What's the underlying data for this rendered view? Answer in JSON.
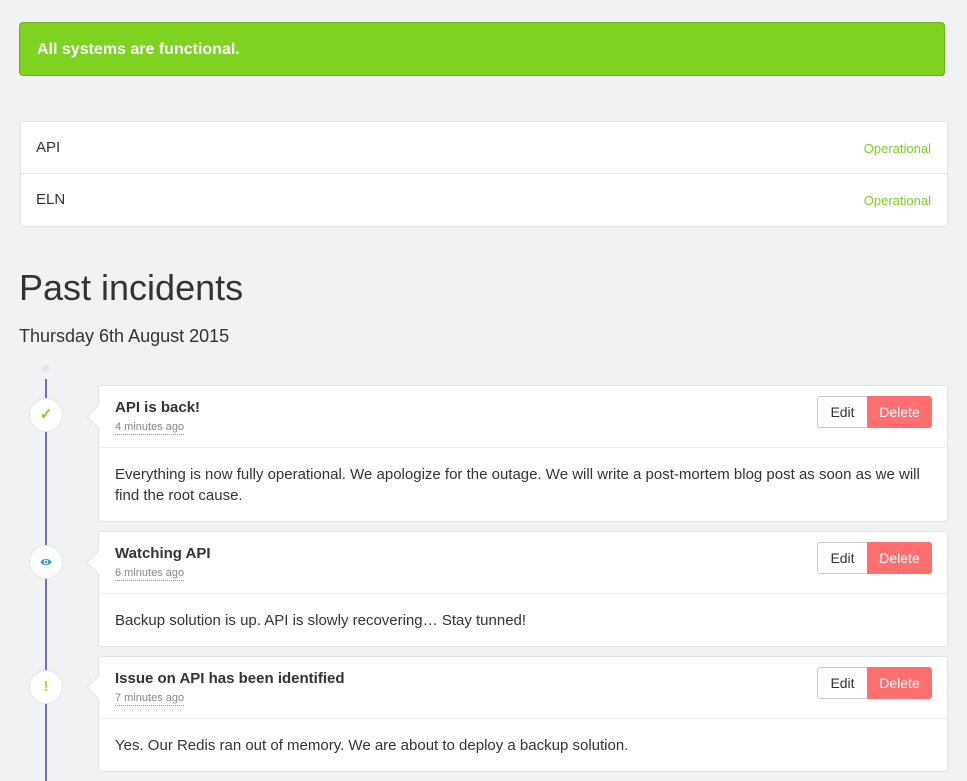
{
  "status_banner": {
    "text": "All systems are functional.",
    "color": "#7ed321"
  },
  "components": [
    {
      "name": "API",
      "status": "Operational"
    },
    {
      "name": "ELN",
      "status": "Operational"
    }
  ],
  "past_incidents": {
    "title": "Past incidents",
    "date": "Thursday 6th August 2015"
  },
  "actions": {
    "edit_label": "Edit",
    "delete_label": "Delete"
  },
  "incidents": [
    {
      "title": "API is back!",
      "time": "4 minutes ago",
      "message": "Everything is now fully operational. We apologize for the outage. We will write a post-mortem blog post as soon as we will find the root cause.",
      "icon": "check-icon",
      "icon_glyph": "✓",
      "icon_color": "#7ed321"
    },
    {
      "title": "Watching API",
      "time": "6 minutes ago",
      "message": "Backup solution is up. API is slowly recovering… Stay tunned!",
      "icon": "eye-icon",
      "icon_glyph": "",
      "icon_color": "#3498db"
    },
    {
      "title": "Issue on API has been identified",
      "time": "7 minutes ago",
      "message": "Yes. Our Redis ran out of memory. We are about to deploy a backup solution.",
      "icon": "exclamation-icon",
      "icon_glyph": "!",
      "icon_color": "#f1c40f"
    }
  ]
}
